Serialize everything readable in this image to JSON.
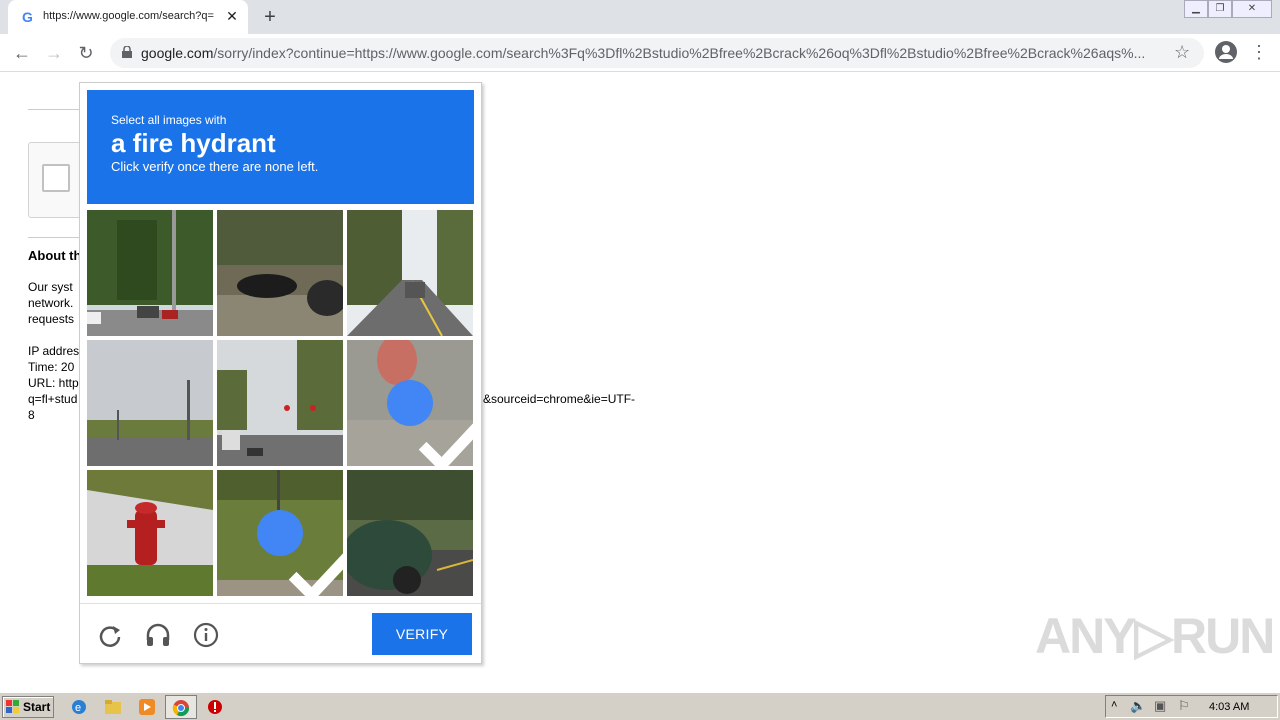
{
  "browser": {
    "tab_title": "https://www.google.com/search?q=",
    "tab_close": "✕",
    "new_tab": "+",
    "url_host": "google.com",
    "url_rest": "/sorry/index?continue=https://www.google.com/search%3Fq%3Dfl%2Bstudio%2Bfree%2Bcrack%26oq%3Dfl%2Bstudio%2Bfree%2Bcrack%26aqs%...",
    "back": "←",
    "forward": "→",
    "reload": "↻",
    "star": "☆",
    "menu": "⋮"
  },
  "page": {
    "about_heading": "About th",
    "para1": [
      "Our syst",
      "network.",
      "requests"
    ],
    "info_lines": [
      "IP addres",
      "Time: 20",
      "URL: http",
      "q=fl+stud",
      "8"
    ],
    "url_tail": "&sourceid=chrome&ie=UTF-"
  },
  "challenge": {
    "small": "Select all images with",
    "big": "a fire hydrant",
    "sub": "Click verify once there are none left.",
    "tiles": [
      {
        "scene": "road-trees-cars",
        "selected": false
      },
      {
        "scene": "parked-car-trees",
        "selected": false
      },
      {
        "scene": "road-forest",
        "selected": false
      },
      {
        "scene": "street-poles-sky",
        "selected": false
      },
      {
        "scene": "traffic-lights-street",
        "selected": false
      },
      {
        "scene": "pavement-closeup",
        "selected": true
      },
      {
        "scene": "fire-hydrant",
        "selected": false
      },
      {
        "scene": "grass-post",
        "selected": true
      },
      {
        "scene": "green-truck",
        "selected": false
      }
    ],
    "verify_label": "VERIFY"
  },
  "watermark": "ANY▷RUN",
  "taskbar": {
    "start_label": "Start",
    "clock": "4:03 AM"
  }
}
